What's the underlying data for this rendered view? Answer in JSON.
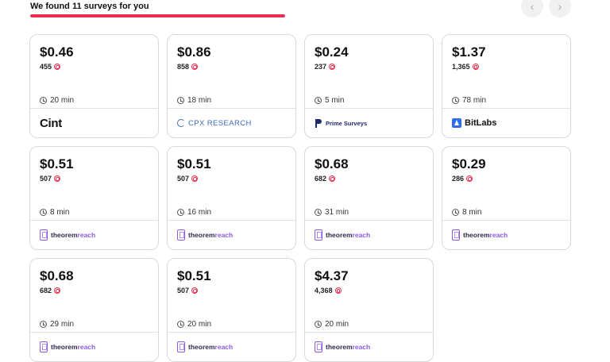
{
  "header": {
    "title": "We found 11 surveys for you",
    "progress_fraction": 1.0
  },
  "nav": {
    "prev_icon": "chevron-left-icon",
    "next_icon": "chevron-right-icon",
    "prev_glyph": "‹",
    "next_glyph": "›"
  },
  "colors": {
    "accent": "#e8304e",
    "border": "#d9d9d9",
    "theorem_purple": "#8c5be0",
    "cpx_blue": "#3e6ab8",
    "bitlabs_blue": "#2d6ef0"
  },
  "surveys": [
    {
      "price": "$0.46",
      "points": "455",
      "time": "20 min",
      "provider": "cint",
      "provider_label": "Cint"
    },
    {
      "price": "$0.86",
      "points": "858",
      "time": "18 min",
      "provider": "cpx",
      "provider_label": "CPX RESEARCH"
    },
    {
      "price": "$0.24",
      "points": "237",
      "time": "5 min",
      "provider": "prime",
      "provider_label": "Prime Surveys"
    },
    {
      "price": "$1.37",
      "points": "1,365",
      "time": "78 min",
      "provider": "bitlabs",
      "provider_label": "BitLabs"
    },
    {
      "price": "$0.51",
      "points": "507",
      "time": "8 min",
      "provider": "theorem",
      "provider_label": "theorem",
      "provider_label_suffix": "reach"
    },
    {
      "price": "$0.51",
      "points": "507",
      "time": "16 min",
      "provider": "theorem",
      "provider_label": "theorem",
      "provider_label_suffix": "reach"
    },
    {
      "price": "$0.68",
      "points": "682",
      "time": "31 min",
      "provider": "theorem",
      "provider_label": "theorem",
      "provider_label_suffix": "reach"
    },
    {
      "price": "$0.29",
      "points": "286",
      "time": "8 min",
      "provider": "theorem",
      "provider_label": "theorem",
      "provider_label_suffix": "reach"
    },
    {
      "price": "$0.68",
      "points": "682",
      "time": "29 min",
      "provider": "theorem",
      "provider_label": "theorem",
      "provider_label_suffix": "reach"
    },
    {
      "price": "$0.51",
      "points": "507",
      "time": "20 min",
      "provider": "theorem",
      "provider_label": "theorem",
      "provider_label_suffix": "reach"
    },
    {
      "price": "$4.37",
      "points": "4,368",
      "time": "20 min",
      "provider": "theorem",
      "provider_label": "theorem",
      "provider_label_suffix": "reach"
    }
  ]
}
